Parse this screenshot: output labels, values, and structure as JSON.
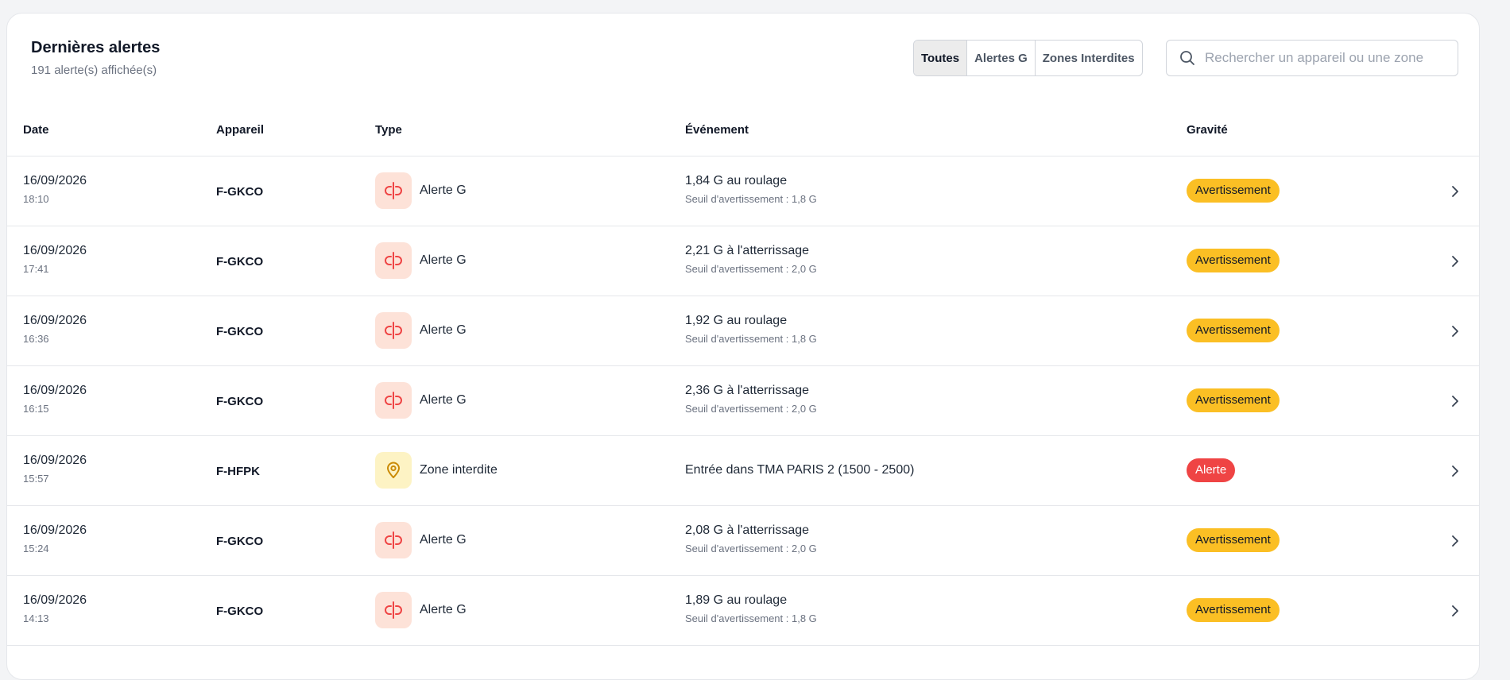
{
  "header": {
    "title": "Dernières alertes",
    "subtitle": "191 alerte(s) affichée(s)"
  },
  "filters": [
    {
      "label": "Toutes",
      "active": true
    },
    {
      "label": "Alertes G",
      "active": false
    },
    {
      "label": "Zones Interdites",
      "active": false
    }
  ],
  "search": {
    "placeholder": "Rechercher un appareil ou une zone",
    "value": "",
    "icon": "search-icon"
  },
  "table": {
    "columns": {
      "date": "Date",
      "device": "Appareil",
      "type": "Type",
      "event": "Événement",
      "severity": "Gravité"
    },
    "rows": [
      {
        "date": "16/09/2026",
        "time": "18:10",
        "device": "F-GKCO",
        "type": "Alerte G",
        "type_kind": "g",
        "event": "1,84 G au roulage",
        "threshold": "Seuil d'avertissement : 1,8 G",
        "severity": "Avertissement",
        "severity_kind": "warn"
      },
      {
        "date": "16/09/2026",
        "time": "17:41",
        "device": "F-GKCO",
        "type": "Alerte G",
        "type_kind": "g",
        "event": "2,21 G à l'atterrissage",
        "threshold": "Seuil d'avertissement : 2,0 G",
        "severity": "Avertissement",
        "severity_kind": "warn"
      },
      {
        "date": "16/09/2026",
        "time": "16:36",
        "device": "F-GKCO",
        "type": "Alerte G",
        "type_kind": "g",
        "event": "1,92 G au roulage",
        "threshold": "Seuil d'avertissement : 1,8 G",
        "severity": "Avertissement",
        "severity_kind": "warn"
      },
      {
        "date": "16/09/2026",
        "time": "16:15",
        "device": "F-GKCO",
        "type": "Alerte G",
        "type_kind": "g",
        "event": "2,36 G à l'atterrissage",
        "threshold": "Seuil d'avertissement : 2,0 G",
        "severity": "Avertissement",
        "severity_kind": "warn"
      },
      {
        "date": "16/09/2026",
        "time": "15:57",
        "device": "F-HFPK",
        "type": "Zone interdite",
        "type_kind": "zone",
        "event": "Entrée dans TMA PARIS 2 (1500 - 2500)",
        "threshold": "",
        "severity": "Alerte",
        "severity_kind": "alert"
      },
      {
        "date": "16/09/2026",
        "time": "15:24",
        "device": "F-GKCO",
        "type": "Alerte G",
        "type_kind": "g",
        "event": "2,08 G à l'atterrissage",
        "threshold": "Seuil d'avertissement : 2,0 G",
        "severity": "Avertissement",
        "severity_kind": "warn"
      },
      {
        "date": "16/09/2026",
        "time": "14:13",
        "device": "F-GKCO",
        "type": "Alerte G",
        "type_kind": "g",
        "event": "1,89 G au roulage",
        "threshold": "Seuil d'avertissement : 1,8 G",
        "severity": "Avertissement",
        "severity_kind": "warn"
      }
    ]
  },
  "colors": {
    "warning": "#fbbf24",
    "alert": "#ef4444",
    "g_icon": "#ef4444",
    "zone_icon": "#ca8a04"
  }
}
